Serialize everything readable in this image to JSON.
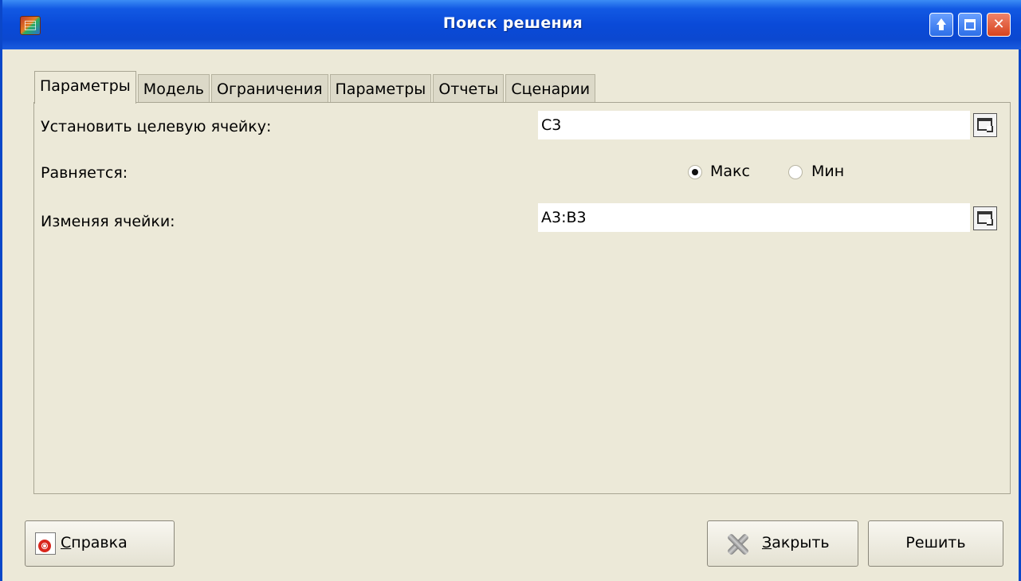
{
  "window": {
    "title": "Поиск решения",
    "colors": {
      "titlebar": "#0b48d0",
      "close": "#d6431e",
      "background": "#ece9d8"
    }
  },
  "tabs": [
    {
      "label": "Параметры",
      "active": true
    },
    {
      "label": "Модель",
      "active": false
    },
    {
      "label": "Ограничения",
      "active": false
    },
    {
      "label": "Параметры",
      "active": false
    },
    {
      "label": "Отчеты",
      "active": false
    },
    {
      "label": "Сценарии",
      "active": false
    }
  ],
  "form": {
    "target_label": "Установить целевую ячейку:",
    "target_value": "C3",
    "equals_label": "Равняется:",
    "radio_max": {
      "label": "Макс",
      "selected": true
    },
    "radio_min": {
      "label": "Мин",
      "selected": false
    },
    "changing_label": "Изменяя ячейки:",
    "changing_value": "A3:B3"
  },
  "buttons": {
    "help_hotkey": "С",
    "help_rest": "правка",
    "close_hotkey": "З",
    "close_rest": "акрыть",
    "solve": "Решить"
  },
  "icons": {
    "app": "spreadsheet-icon",
    "range_picker": "cell-range-picker-icon",
    "help": "lifebuoy-icon",
    "close": "x-icon"
  }
}
